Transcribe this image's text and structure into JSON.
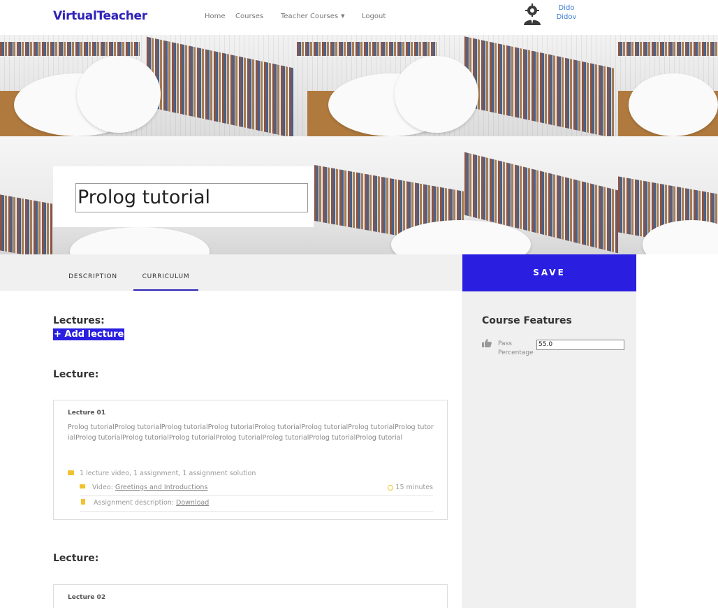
{
  "header": {
    "brand": "VirtualTeacher",
    "nav": {
      "home": "Home",
      "courses": "Courses",
      "teacher_courses": "Teacher Courses",
      "logout": "Logout"
    },
    "user": {
      "first_name": "Dido",
      "last_name": "Didov"
    }
  },
  "course": {
    "title": "Prolog tutorial"
  },
  "tabs": {
    "description": "DESCRIPTION",
    "curriculum": "CURRICULUM",
    "active": "curriculum"
  },
  "save_label": "SAVE",
  "sidebar": {
    "title": "Course Features",
    "pass_label": "Pass Percentage",
    "pass_value": "55.0"
  },
  "main": {
    "lectures_heading": "Lectures:",
    "add_lecture": "+ Add lecture",
    "lecture_heading": "Lecture:",
    "lectures": [
      {
        "title": "Lecture 01",
        "description": "Prolog tutorialProlog tutorialProlog tutorialProlog tutorialProlog tutorialProlog tutorialProlog tutorialProlog tutorialProlog tutorialProlog tutorialProlog tutorialProlog tutorialProlog tutorialProlog tutorialProlog tutorial",
        "meta": "1 lecture video, 1 assignment, 1 assignment solution",
        "video_label": "Video:",
        "video_title": "Greetings and Introductions",
        "duration": "15 minutes",
        "assignment_label": "Assignment description:",
        "assignment_link": "Download"
      },
      {
        "title": "Lecture 02"
      }
    ]
  },
  "colors": {
    "brand": "#2e22b8",
    "accent": "#2a1fe0",
    "icon_yellow": "#f2c12e"
  }
}
